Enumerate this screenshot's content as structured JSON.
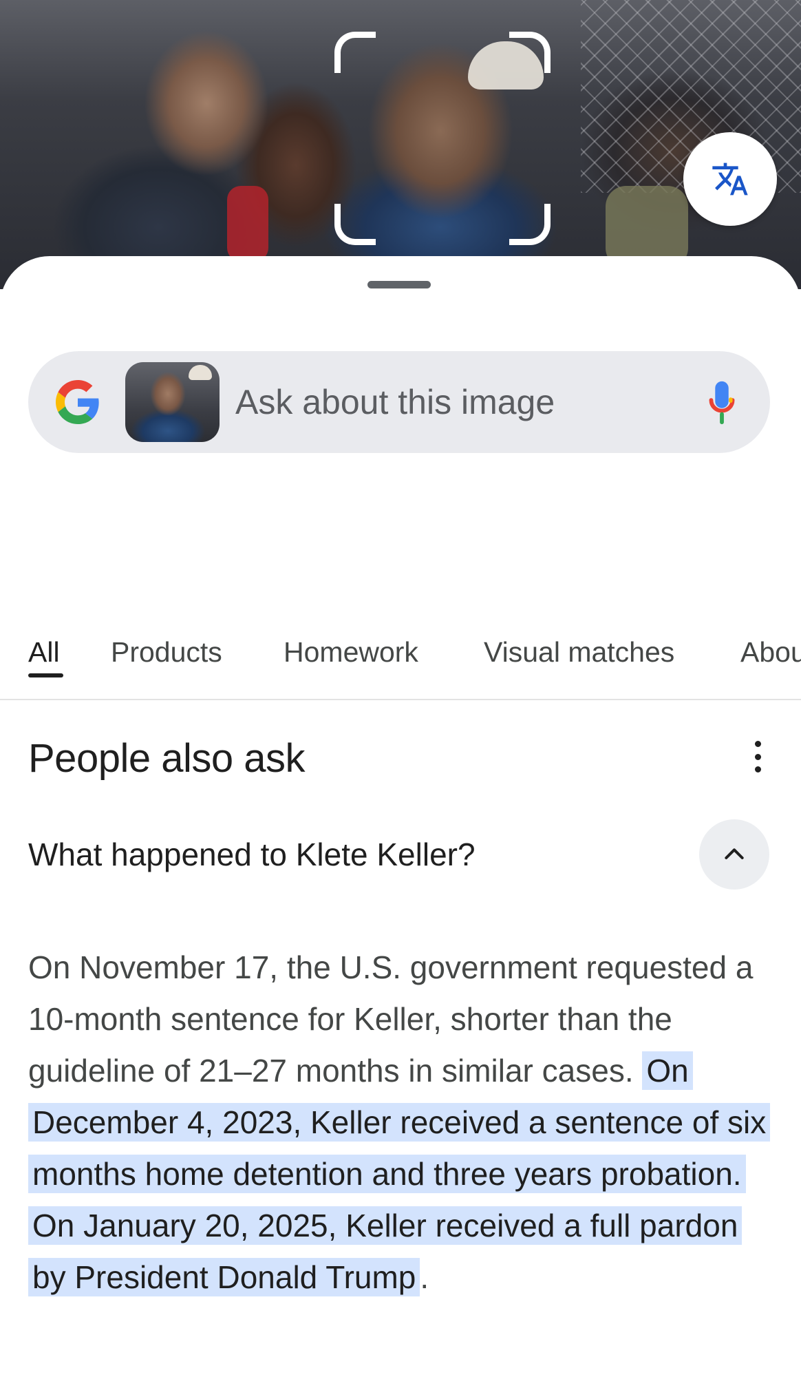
{
  "photo": {
    "description_icon": "translate-icon"
  },
  "search": {
    "placeholder": "Ask about this image",
    "logo_icon": "google-g-logo",
    "mic_icon": "mic-icon"
  },
  "tabs": [
    {
      "label": "All",
      "active": true
    },
    {
      "label": "Products",
      "active": false
    },
    {
      "label": "Homework",
      "active": false
    },
    {
      "label": "Visual matches",
      "active": false
    },
    {
      "label": "About this image",
      "active": false
    }
  ],
  "people_also_ask": {
    "title": "People also ask",
    "more_icon": "more-vert-icon",
    "question": "What happened to Klete Keller?",
    "collapse_icon": "chevron-up-icon",
    "answer_plain": "On November 17, the U.S. government requested a 10-month sentence for Keller, shorter than the guideline of 21–27 months in similar cases.",
    "answer_highlight_1": "On December 4, 2023, Keller received a sentence of six months home detention and three years probation.",
    "answer_highlight_2": "On January 20, 2025, Keller received a full pardon by President Donald Trump",
    "answer_end": "."
  },
  "colors": {
    "highlight": "#d3e3fd",
    "search_bg": "#e9eaee",
    "text_primary": "#1f1f1f",
    "text_secondary": "#444746",
    "google_blue": "#4285F4",
    "google_red": "#EA4335",
    "google_yellow": "#FBBC05",
    "google_green": "#34A853"
  }
}
